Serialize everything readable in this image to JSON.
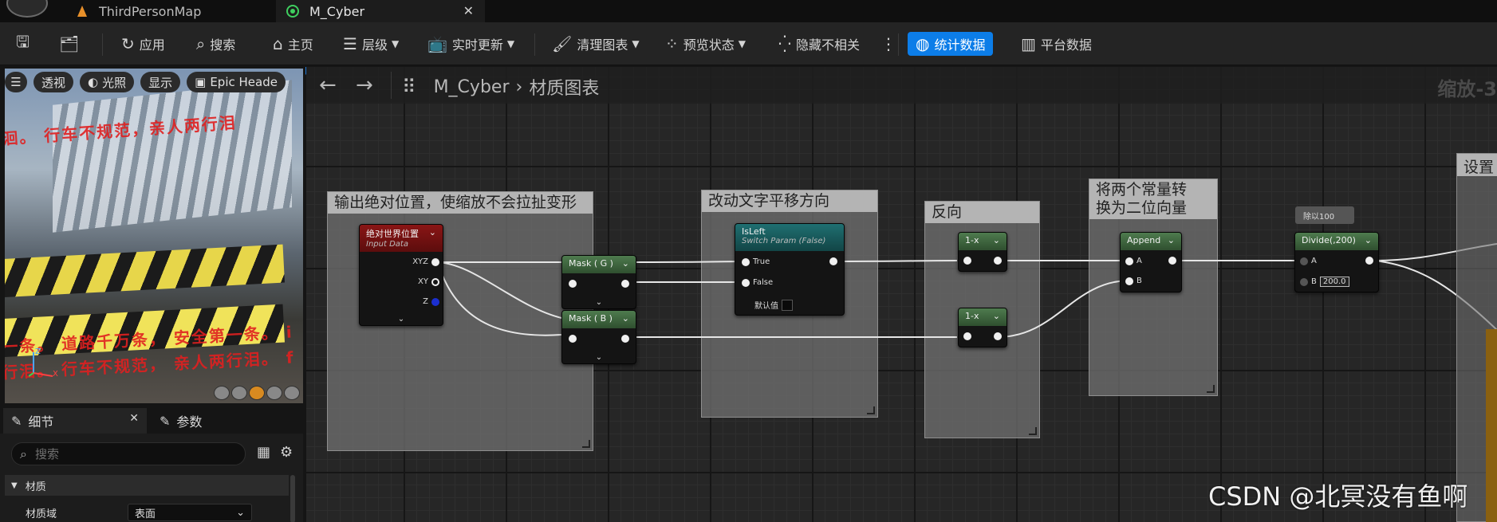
{
  "tabs": [
    {
      "label": "ThirdPersonMap",
      "icon": "level-icon"
    },
    {
      "label": "M_Cyber",
      "icon": "material-icon"
    }
  ],
  "toolbar": {
    "save_icon": "save-icon",
    "browse_icon": "browse-icon",
    "apply": "应用",
    "search": "搜索",
    "home": "主页",
    "hierarchy": "层级",
    "live_update": "实时更新",
    "clean_graph": "清理图表",
    "preview_state": "预览状态",
    "hide_unrelated": "隐藏不相关",
    "stats": "统计数据",
    "platform_stats": "平台数据"
  },
  "viewport": {
    "buttons": [
      "透视",
      "光照",
      "显示",
      "Epic Heade"
    ],
    "overlay_lines": [
      "洄。 行车不规范，亲人两行泪",
      "一条。 道路千万条， 安全第一条。 i",
      "行泪。 行车不规范， 亲人两行泪。 f"
    ]
  },
  "details": {
    "tab_details": "细节",
    "tab_params": "参数",
    "search_placeholder": "搜索",
    "section": "材质",
    "row_label": "材质域",
    "row_value": "表面"
  },
  "graph": {
    "breadcrumb_asset": "M_Cyber",
    "breadcrumb_graph": "材质图表",
    "zoom": "缩放-3",
    "comments": [
      "输出绝对位置，使缩放不会拉扯变形",
      "改动文字平移方向",
      "反向",
      "将两个常量转\n换为二位向量",
      "设置"
    ],
    "nodes": {
      "world_pos": {
        "title": "绝对世界位置",
        "subtitle": "Input Data",
        "pins": [
          "XYZ",
          "XY",
          "Z"
        ]
      },
      "mask_g": {
        "title": "Mask ( G )"
      },
      "mask_b": {
        "title": "Mask ( B )"
      },
      "isleft": {
        "title": "IsLeft",
        "subtitle": "Switch Param (False)",
        "pins": [
          "True",
          "False"
        ],
        "default_label": "默认值"
      },
      "oneminus1": {
        "title": "1-x"
      },
      "oneminus2": {
        "title": "1-x"
      },
      "append": {
        "title": "Append",
        "pins": [
          "A",
          "B"
        ]
      },
      "divide": {
        "title": "Divide(,200)",
        "pins": [
          "A",
          "B"
        ],
        "b_value": "200.0"
      }
    },
    "tooltip": "除以100",
    "watermark": "CSDN @北冥没有鱼啊"
  }
}
